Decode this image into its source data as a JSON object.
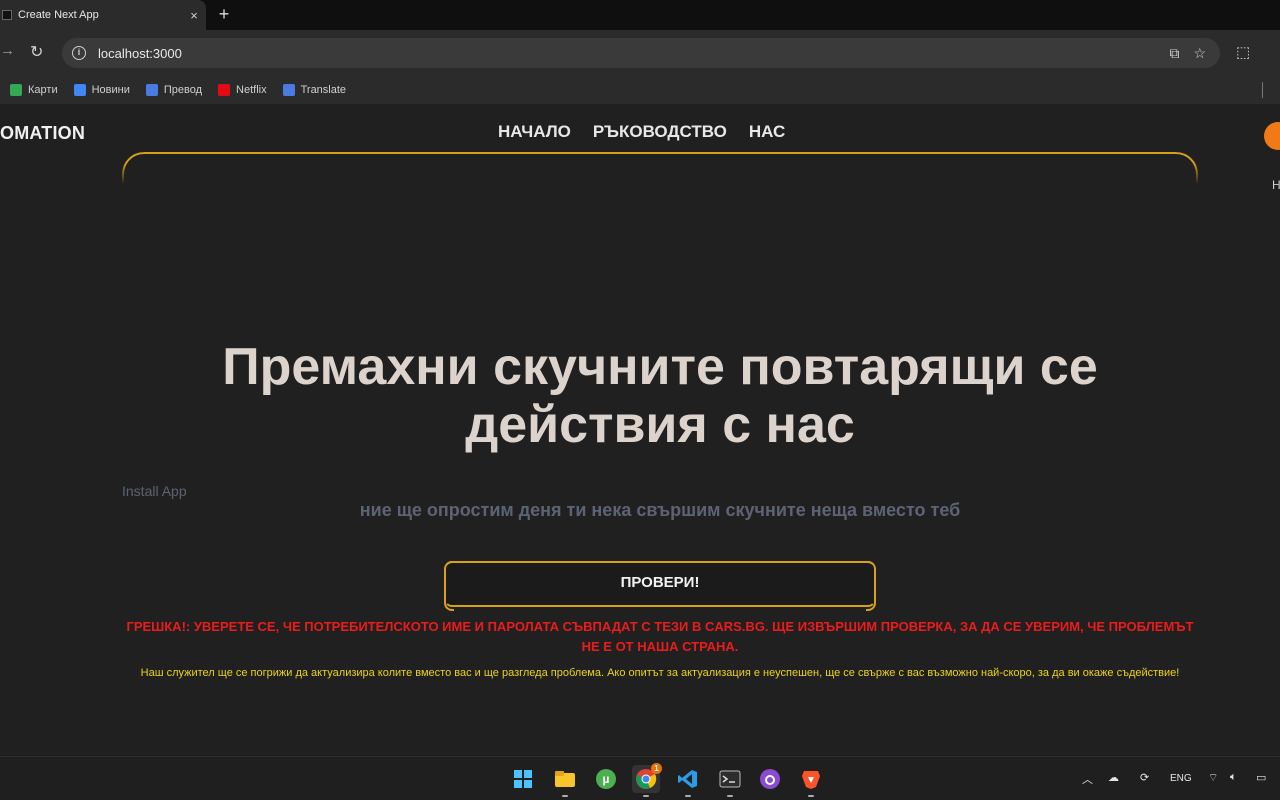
{
  "browser": {
    "tab_title": "Create Next App",
    "tab_close": "×",
    "new_tab": "+",
    "url": "localhost:3000",
    "bookmarks": [
      {
        "label": "Карти",
        "icon": "maps-icon",
        "color": "#34a853"
      },
      {
        "label": "Новини",
        "icon": "news-icon",
        "color": "#4285f4"
      },
      {
        "label": "Превод",
        "icon": "translate-icon",
        "color": "#4a7be0"
      },
      {
        "label": "Netflix",
        "icon": "netflix-icon",
        "color": "#e50914"
      },
      {
        "label": "Translate",
        "icon": "translate-icon",
        "color": "#4a7be0"
      }
    ]
  },
  "site": {
    "brand": "OMATION",
    "nav": [
      "НАЧАЛО",
      "РЪКОВОДСТВО",
      "НАС"
    ],
    "side_letter": "H",
    "headline": "Премахни скучните повтарящи се действия с нас",
    "install_label": "Install App",
    "subline": "ние ще опростим деня ти нека свършим скучните неща вместо теб",
    "check_button": "ПРОВЕРИ!",
    "error_text": "ГРЕШКА!: УВЕРЕТЕ СЕ, ЧЕ ПОТРЕБИТЕЛСКОТО ИМЕ И ПАРОЛАТА СЪВПАДАТ С ТЕЗИ В CARS.BG. ЩЕ ИЗВЪРШИМ ПРОВЕРКА, ЗА ДА СЕ УВЕРИМ, ЧЕ ПРОБЛЕМЪТ НЕ Е ОТ НАША СТРАНА.",
    "info_text": "Наш служител ще се погрижи да актуализира колите вместо вас и ще разгледа проблема. Ако опитът за актуализация е неуспешен, ще се свърже с вас възможно най-скоро, за да ви окаже съдействие!",
    "colors": {
      "accent": "#d9a11a",
      "error": "#ea1c1c",
      "info": "#ecd21d"
    }
  },
  "taskbar": {
    "apps": [
      "windows-start-icon",
      "file-explorer-icon",
      "utorrent-icon",
      "chrome-icon",
      "vscode-icon",
      "terminal-icon",
      "github-desktop-icon",
      "brave-icon"
    ],
    "chrome_badge": "1",
    "language": "ENG"
  }
}
